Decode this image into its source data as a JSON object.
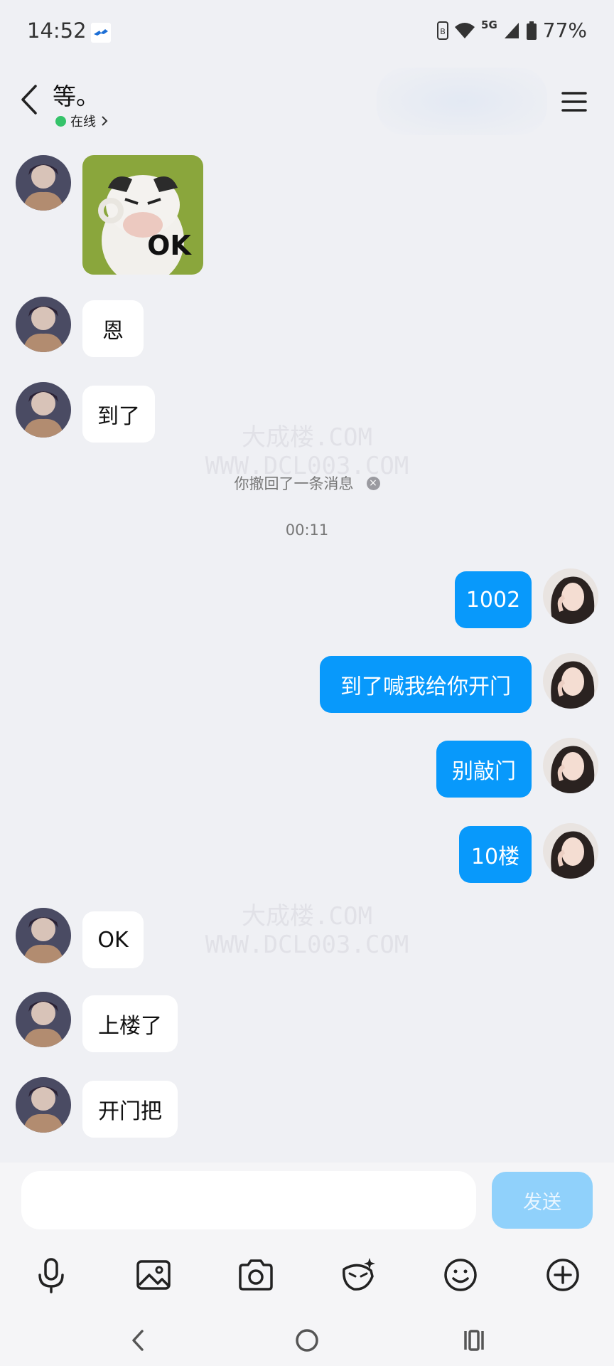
{
  "status_bar": {
    "time": "14:52",
    "network": "5G",
    "battery": "77%"
  },
  "header": {
    "title": "等。",
    "presence": "在线"
  },
  "messages": [
    {
      "side": "in",
      "type": "sticker",
      "sticker_text": "OK"
    },
    {
      "side": "in",
      "type": "text",
      "text": "恩"
    },
    {
      "side": "in",
      "type": "text",
      "text": "到了"
    },
    {
      "side": "out",
      "type": "text",
      "text": "1002"
    },
    {
      "side": "out",
      "type": "text",
      "text": "到了喊我给你开门"
    },
    {
      "side": "out",
      "type": "text",
      "text": "别敲门"
    },
    {
      "side": "out",
      "type": "text",
      "text": "10楼"
    },
    {
      "side": "in",
      "type": "text",
      "text": "OK"
    },
    {
      "side": "in",
      "type": "text",
      "text": "上楼了"
    },
    {
      "side": "in",
      "type": "text",
      "text": "开门把"
    }
  ],
  "system_note": "你撤回了一条消息",
  "time_separator": "00:11",
  "watermark": {
    "line1": "大成楼.COM",
    "line2": "WWW.DCL003.COM"
  },
  "composer": {
    "input_value": "",
    "send_label": "发送"
  },
  "toolbar_icons": [
    "microphone-icon",
    "image-icon",
    "camera-icon",
    "sticker-icon",
    "emoji-icon",
    "plus-icon"
  ],
  "colors": {
    "outgoing_bubble": "#0899fb",
    "incoming_bubble": "#ffffff",
    "background": "#eff0f4",
    "send_button": "#90d1fb",
    "online_dot": "#35c36a"
  }
}
